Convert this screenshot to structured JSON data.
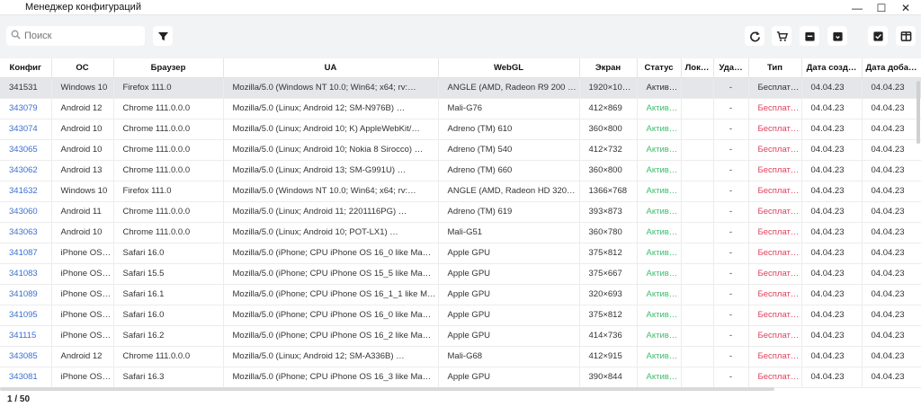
{
  "window": {
    "title": "Менеджер конфигураций",
    "minimize_glyph": "—",
    "maximize_glyph": "☐",
    "close_glyph": "✕"
  },
  "toolbar": {
    "search_placeholder": "Поиск",
    "icons": [
      "search-icon",
      "filter-icon",
      "refresh-icon",
      "cart-icon",
      "archive-icon",
      "archive-alt-icon",
      "check-box-icon",
      "columns-icon"
    ]
  },
  "colors": {
    "link": "#3b6fd1",
    "active": "#3ebd6c",
    "free": "#e0405c",
    "selected_row": "#e4e6e9"
  },
  "table": {
    "columns": [
      "Конфиг",
      "ОС",
      "Браузер",
      "UA",
      "WebGL",
      "Экран",
      "Статус",
      "Лок…",
      "Уда…",
      "Тип",
      "Дата созд…",
      "Дата доба…"
    ],
    "rows": [
      {
        "id": "341531",
        "os": "Windows 10",
        "browser": "Firefox 111.0",
        "ua": "Mozilla/5.0 (Windows NT 10.0; Win64; x64; rv:…",
        "webgl": "ANGLE (AMD, Radeon R9 200 …",
        "screen": "1920×10…",
        "status": "Актив…",
        "lock": "",
        "del": "-",
        "type": "Бесплат…",
        "created": "04.04.23",
        "added": "04.04.23",
        "selected": true
      },
      {
        "id": "343079",
        "os": "Android 12",
        "browser": "Chrome 111.0.0.0",
        "ua": "Mozilla/5.0 (Linux; Android 12; SM-N976B) …",
        "webgl": "Mali-G76",
        "screen": "412×869",
        "status": "Актив…",
        "lock": "",
        "del": "-",
        "type": "Бесплат…",
        "created": "04.04.23",
        "added": "04.04.23"
      },
      {
        "id": "343074",
        "os": "Android 10",
        "browser": "Chrome 111.0.0.0",
        "ua": "Mozilla/5.0 (Linux; Android 10; K) AppleWebKit/…",
        "webgl": "Adreno (TM) 610",
        "screen": "360×800",
        "status": "Актив…",
        "lock": "",
        "del": "-",
        "type": "Бесплат…",
        "created": "04.04.23",
        "added": "04.04.23"
      },
      {
        "id": "343065",
        "os": "Android 10",
        "browser": "Chrome 111.0.0.0",
        "ua": "Mozilla/5.0 (Linux; Android 10; Nokia 8 Sirocco) …",
        "webgl": "Adreno (TM) 540",
        "screen": "412×732",
        "status": "Актив…",
        "lock": "",
        "del": "-",
        "type": "Бесплат…",
        "created": "04.04.23",
        "added": "04.04.23"
      },
      {
        "id": "343062",
        "os": "Android 13",
        "browser": "Chrome 111.0.0.0",
        "ua": "Mozilla/5.0 (Linux; Android 13; SM-G991U) …",
        "webgl": "Adreno (TM) 660",
        "screen": "360×800",
        "status": "Актив…",
        "lock": "",
        "del": "-",
        "type": "Бесплат…",
        "created": "04.04.23",
        "added": "04.04.23"
      },
      {
        "id": "341632",
        "os": "Windows 10",
        "browser": "Firefox 111.0",
        "ua": "Mozilla/5.0 (Windows NT 10.0; Win64; x64; rv:…",
        "webgl": "ANGLE (AMD, Radeon HD 320…",
        "screen": "1366×768",
        "status": "Актив…",
        "lock": "",
        "del": "-",
        "type": "Бесплат…",
        "created": "04.04.23",
        "added": "04.04.23"
      },
      {
        "id": "343060",
        "os": "Android 11",
        "browser": "Chrome 111.0.0.0",
        "ua": "Mozilla/5.0 (Linux; Android 11; 2201116PG) …",
        "webgl": "Adreno (TM) 619",
        "screen": "393×873",
        "status": "Актив…",
        "lock": "",
        "del": "-",
        "type": "Бесплат…",
        "created": "04.04.23",
        "added": "04.04.23"
      },
      {
        "id": "343063",
        "os": "Android 10",
        "browser": "Chrome 111.0.0.0",
        "ua": "Mozilla/5.0 (Linux; Android 10; POT-LX1) …",
        "webgl": "Mali-G51",
        "screen": "360×780",
        "status": "Актив…",
        "lock": "",
        "del": "-",
        "type": "Бесплат…",
        "created": "04.04.23",
        "added": "04.04.23"
      },
      {
        "id": "341087",
        "os": "iPhone OS…",
        "browser": "Safari 16.0",
        "ua": "Mozilla/5.0 (iPhone; CPU iPhone OS 16_0 like Ma…",
        "webgl": "Apple GPU",
        "screen": "375×812",
        "status": "Актив…",
        "lock": "",
        "del": "-",
        "type": "Бесплат…",
        "created": "04.04.23",
        "added": "04.04.23"
      },
      {
        "id": "341083",
        "os": "iPhone OS…",
        "browser": "Safari 15.5",
        "ua": "Mozilla/5.0 (iPhone; CPU iPhone OS 15_5 like Ma…",
        "webgl": "Apple GPU",
        "screen": "375×667",
        "status": "Актив…",
        "lock": "",
        "del": "-",
        "type": "Бесплат…",
        "created": "04.04.23",
        "added": "04.04.23"
      },
      {
        "id": "341089",
        "os": "iPhone OS…",
        "browser": "Safari 16.1",
        "ua": "Mozilla/5.0 (iPhone; CPU iPhone OS 16_1_1 like M…",
        "webgl": "Apple GPU",
        "screen": "320×693",
        "status": "Актив…",
        "lock": "",
        "del": "-",
        "type": "Бесплат…",
        "created": "04.04.23",
        "added": "04.04.23"
      },
      {
        "id": "341095",
        "os": "iPhone OS…",
        "browser": "Safari 16.0",
        "ua": "Mozilla/5.0 (iPhone; CPU iPhone OS 16_0 like Ma…",
        "webgl": "Apple GPU",
        "screen": "375×812",
        "status": "Актив…",
        "lock": "",
        "del": "-",
        "type": "Бесплат…",
        "created": "04.04.23",
        "added": "04.04.23"
      },
      {
        "id": "341115",
        "os": "iPhone OS…",
        "browser": "Safari 16.2",
        "ua": "Mozilla/5.0 (iPhone; CPU iPhone OS 16_2 like Ma…",
        "webgl": "Apple GPU",
        "screen": "414×736",
        "status": "Актив…",
        "lock": "",
        "del": "-",
        "type": "Бесплат…",
        "created": "04.04.23",
        "added": "04.04.23"
      },
      {
        "id": "343085",
        "os": "Android 12",
        "browser": "Chrome 111.0.0.0",
        "ua": "Mozilla/5.0 (Linux; Android 12; SM-A336B) …",
        "webgl": "Mali-G68",
        "screen": "412×915",
        "status": "Актив…",
        "lock": "",
        "del": "-",
        "type": "Бесплат…",
        "created": "04.04.23",
        "added": "04.04.23"
      },
      {
        "id": "343081",
        "os": "iPhone OS…",
        "browser": "Safari 16.3",
        "ua": "Mozilla/5.0 (iPhone; CPU iPhone OS 16_3 like Ma…",
        "webgl": "Apple GPU",
        "screen": "390×844",
        "status": "Актив…",
        "lock": "",
        "del": "-",
        "type": "Бесплат…",
        "created": "04.04.23",
        "added": "04.04.23"
      }
    ]
  },
  "footer": {
    "pagination": "1 / 50"
  }
}
